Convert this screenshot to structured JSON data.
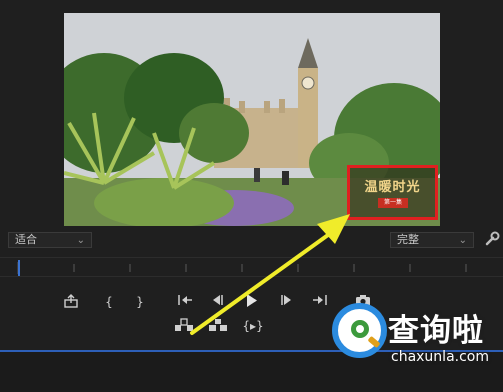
{
  "monitor": {
    "overlay": {
      "title": "温暖时光",
      "badge": "第一集"
    }
  },
  "controls": {
    "zoom_select": "适合",
    "resolution_select": "完整",
    "chevron": "⌄"
  },
  "transport": {
    "mark_in": "{",
    "mark_out": "}",
    "insert_label": "{▸}"
  },
  "watermark": {
    "title": "查询啦",
    "domain": "chaxunla.com"
  },
  "colors": {
    "highlight_box": "#e02020",
    "arrow": "#f0ec2a",
    "playhead": "#3b73d1"
  },
  "icons": [
    "export-frame-icon",
    "mark-in-icon",
    "mark-out-icon",
    "go-to-in-icon",
    "step-back-icon",
    "play-icon",
    "step-forward-icon",
    "go-to-out-icon",
    "camera-icon",
    "lift-icon",
    "extract-icon",
    "insert-icon",
    "wrench-icon"
  ]
}
